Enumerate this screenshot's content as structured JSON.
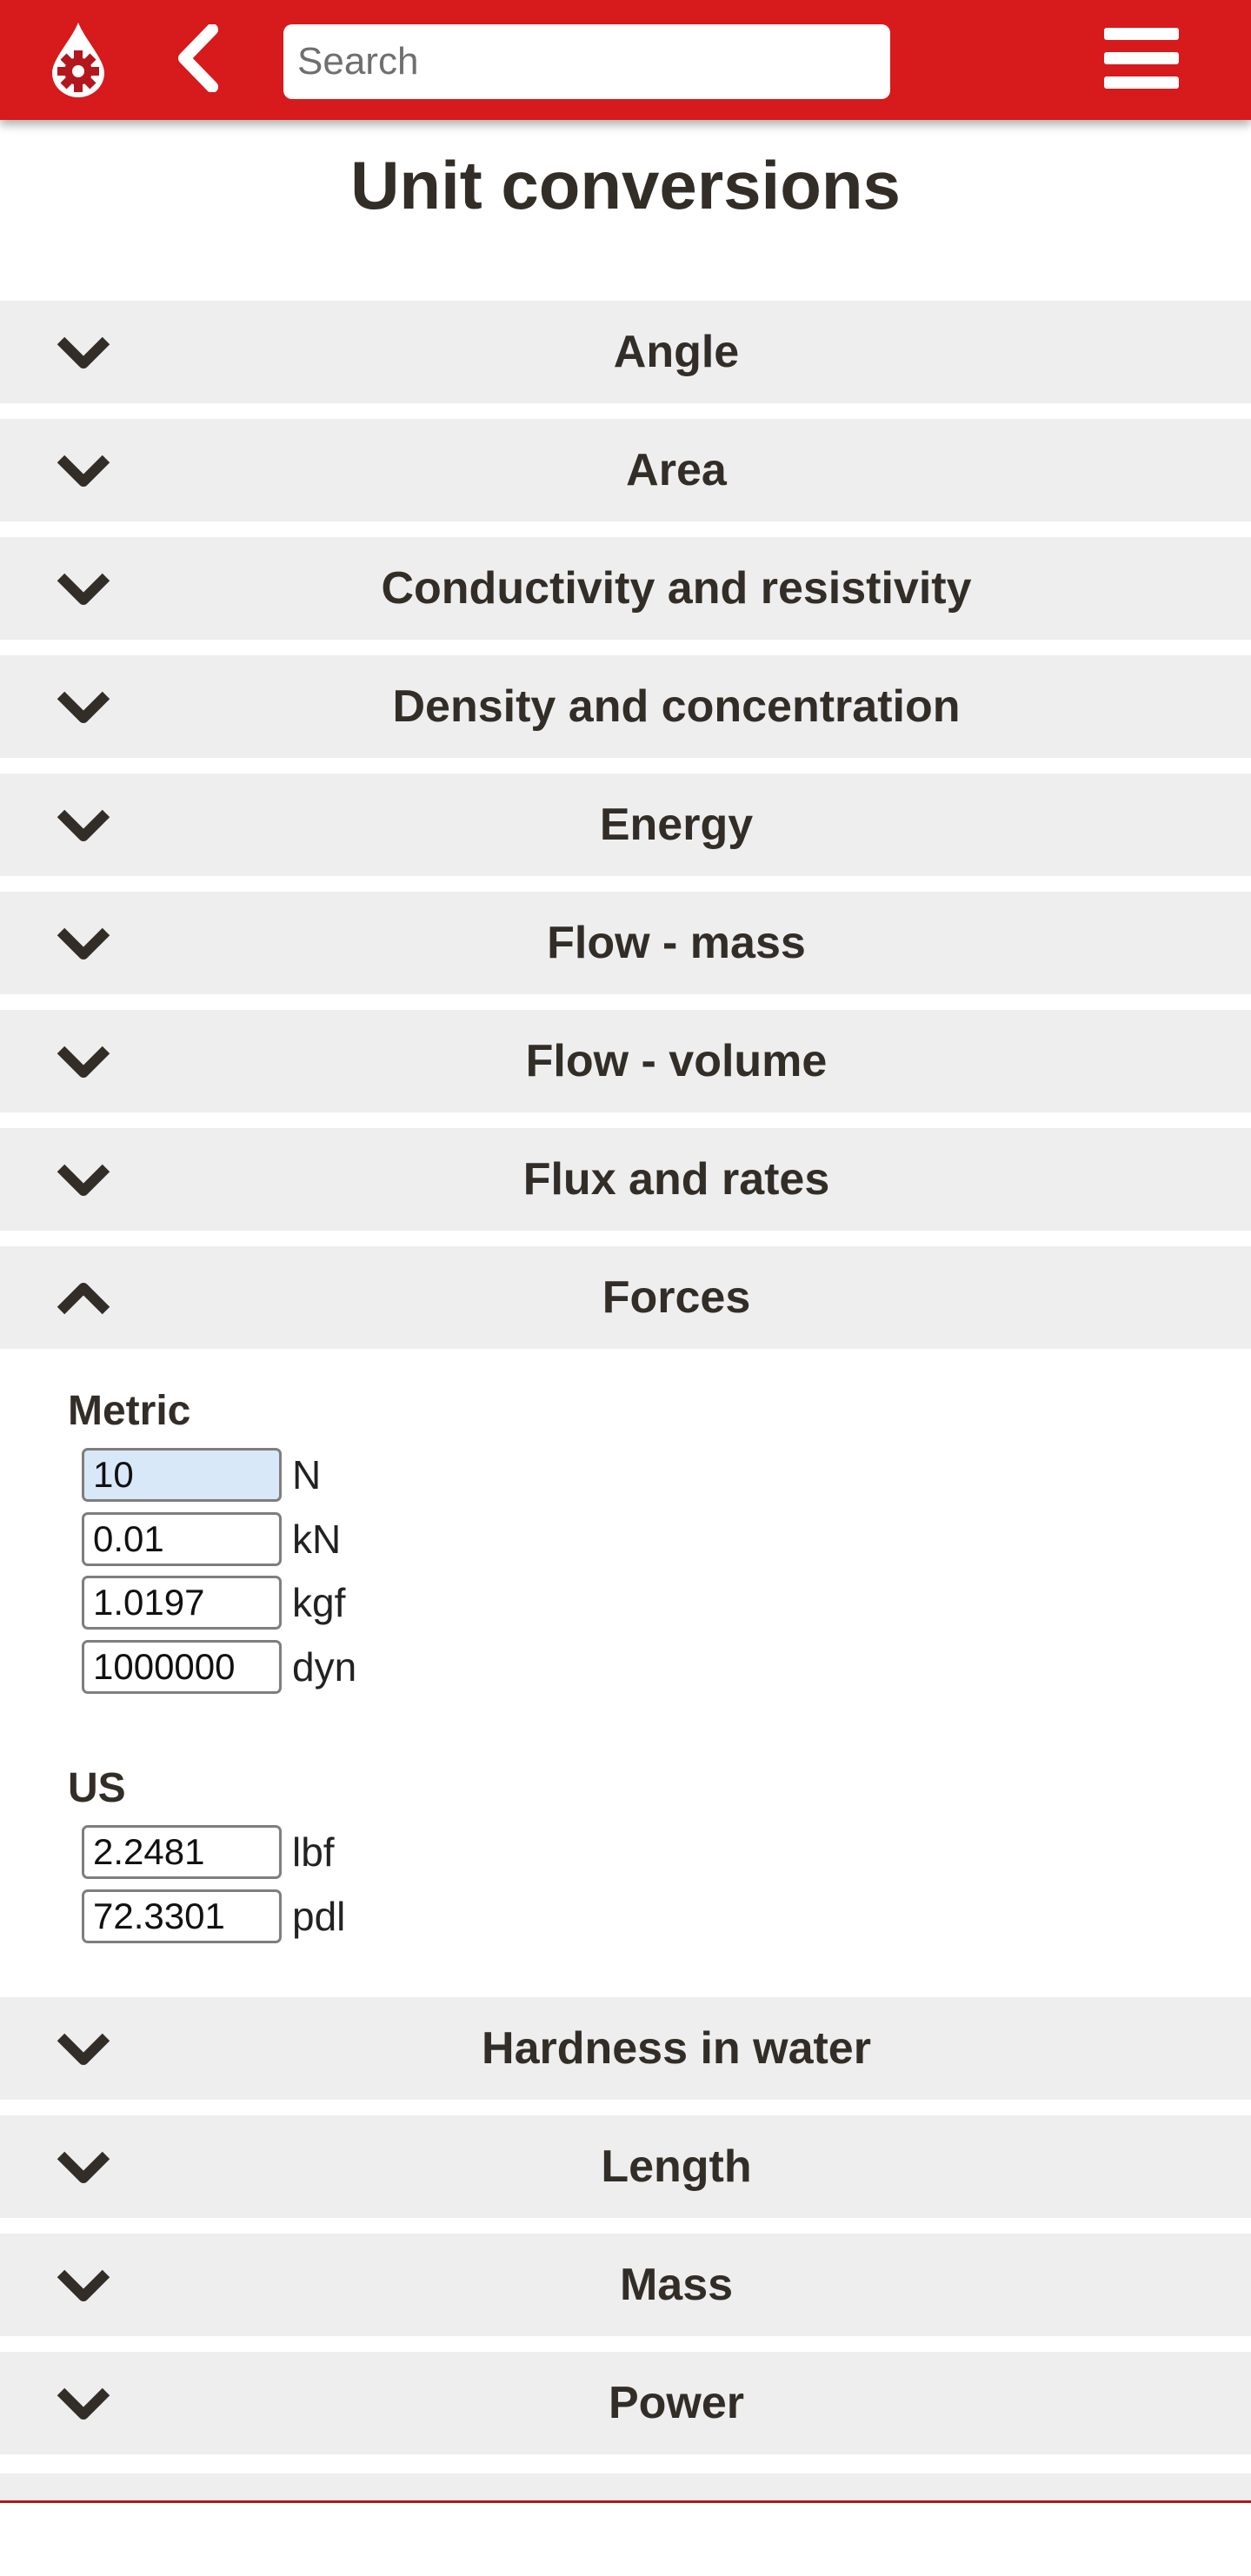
{
  "header": {
    "logo_icon": "droplet-gear-icon",
    "back_icon": "chevron-left-icon",
    "search_placeholder": "Search",
    "search_value": "",
    "menu_icon": "hamburger-menu-icon",
    "brand_color": "#d71a1c"
  },
  "page": {
    "title": "Unit conversions"
  },
  "sections_before": [
    {
      "label": "Angle",
      "expanded": false
    },
    {
      "label": "Area",
      "expanded": false
    },
    {
      "label": "Conductivity and resistivity",
      "expanded": false
    },
    {
      "label": "Density and concentration",
      "expanded": false
    },
    {
      "label": "Energy",
      "expanded": false
    },
    {
      "label": "Flow - mass",
      "expanded": false
    },
    {
      "label": "Flow - volume",
      "expanded": false
    },
    {
      "label": "Flux and rates",
      "expanded": false
    }
  ],
  "forces": {
    "label": "Forces",
    "expanded": true,
    "groups": [
      {
        "label": "Metric",
        "fields": [
          {
            "value": "10",
            "unit": "N",
            "focused": true
          },
          {
            "value": "0.01",
            "unit": "kN",
            "focused": false
          },
          {
            "value": "1.0197",
            "unit": "kgf",
            "focused": false
          },
          {
            "value": "1000000",
            "unit": "dyn",
            "focused": false
          }
        ]
      },
      {
        "label": "US",
        "fields": [
          {
            "value": "2.2481",
            "unit": "lbf",
            "focused": false
          },
          {
            "value": "72.3301",
            "unit": "pdl",
            "focused": false
          }
        ]
      }
    ]
  },
  "sections_after": [
    {
      "label": "Hardness in water",
      "expanded": false
    },
    {
      "label": "Length",
      "expanded": false
    },
    {
      "label": "Mass",
      "expanded": false
    },
    {
      "label": "Power",
      "expanded": false
    },
    {
      "label": "",
      "expanded": false
    }
  ]
}
